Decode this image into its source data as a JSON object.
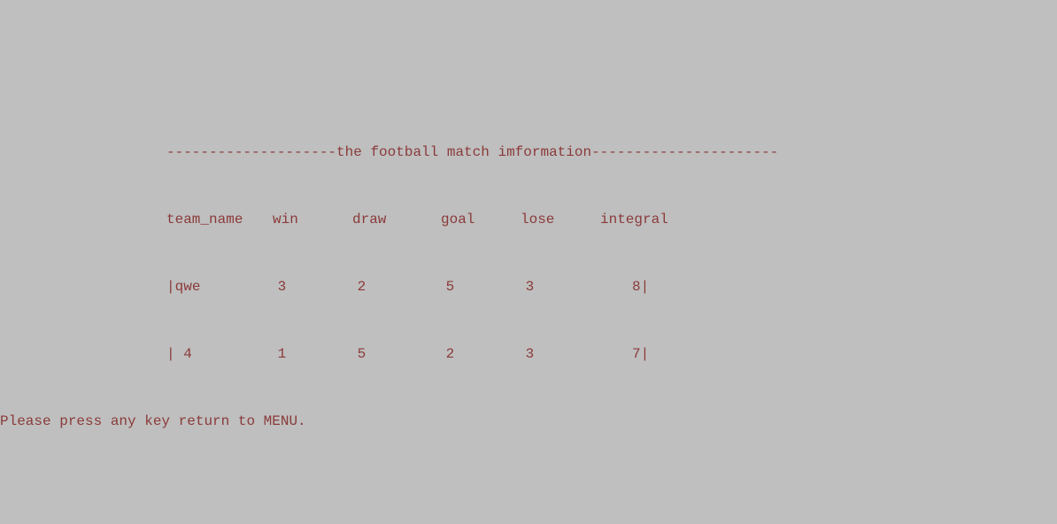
{
  "title_line": "--------------------the football match imformation----------------------",
  "header": {
    "team_name": "team_name",
    "win": "win",
    "draw": "draw",
    "goal": "goal",
    "lose": "lose",
    "integral": "integral"
  },
  "rows": [
    {
      "team_name": "qwe",
      "win": "3",
      "draw": "2",
      "goal": "5",
      "lose": "3",
      "integral": "8"
    },
    {
      "team_name": " 4",
      "win": "1",
      "draw": "5",
      "goal": "2",
      "lose": "3",
      "integral": "7"
    }
  ],
  "pipe": "|",
  "prompt": "Please press any key return to MENU."
}
